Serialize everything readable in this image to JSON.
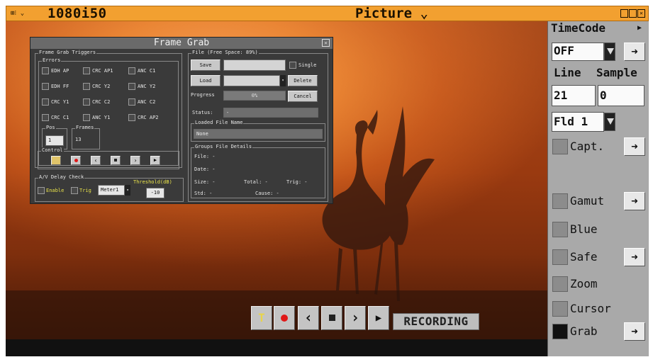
{
  "topbar": {
    "format": "1080i50",
    "view": "Picture ⌄",
    "menu_icon_text": "⊞⁝ ⌄"
  },
  "frame_grab": {
    "title": "Frame Grab",
    "triggers_label": "Frame Grab Triggers",
    "errors_label": "Errors",
    "errors": [
      "EDH AP",
      "CRC AP1",
      "ANC C1",
      "EDH FF",
      "CRC Y2",
      "ANC Y2",
      "CRC Y1",
      "CRC C2",
      "ANC C2",
      "CRC C1",
      "ANC Y1",
      "CRC AP2"
    ],
    "pos_label": "Pos",
    "pos_value": "1",
    "frames_label": "Frames",
    "frames_value": "13",
    "control_label": "Control",
    "av_label": "A/V Delay Check",
    "enable_label": "Enable",
    "trig_label": "Trig",
    "meter_value": "Meter1",
    "threshold_label": "Threshold(dB)",
    "threshold_value": "-10",
    "file_label": "File (Free Space: 89%)",
    "save_label": "Save",
    "single_label": "Single",
    "load_label": "Load",
    "delete_label": "Delete",
    "progress_label": "Progress",
    "progress_value": "0%",
    "progress_fraction": 0,
    "cancel_label": "Cancel",
    "status_label": "Status:",
    "status_value": "-",
    "loaded_label": "Loaded File Name",
    "loaded_value": "None",
    "details_label": "Groups File Details",
    "file_line": "File: -",
    "date_line": "Date: -",
    "size_line": "Size: -",
    "total_line": "Total: -",
    "trig_line": "Trig: -",
    "std_line": "Std: -",
    "cause_line": "Cause: -"
  },
  "video_controls": {
    "trigger_icon": "T",
    "recording_label": "RECORDING"
  },
  "panel": {
    "timecode_label": "TimeCode",
    "timecode_value": "OFF",
    "line_label": "Line",
    "sample_label": "Sample",
    "line_value": "21",
    "sample_value": "0",
    "field_value": "Fld 1",
    "arrow_glyph": "➜",
    "checks": [
      {
        "label": "Capt.",
        "on": false
      },
      {
        "label": "Gamut",
        "on": false
      },
      {
        "label": "Blue",
        "on": false
      },
      {
        "label": "Safe",
        "on": false
      },
      {
        "label": "Zoom",
        "on": false
      },
      {
        "label": "Cursor",
        "on": false
      },
      {
        "label": "Grab",
        "on": true
      }
    ]
  },
  "colors": {
    "accent": "#f2a030",
    "panel": "#a9a9a9",
    "dialog": "#3a3a3a",
    "label_yellow": "#e8e24a",
    "record_red": "#e01818"
  }
}
